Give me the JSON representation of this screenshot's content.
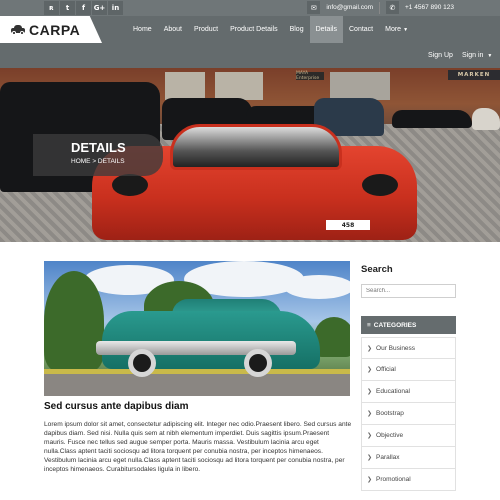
{
  "topbar": {
    "social_icons": [
      {
        "name": "rss-icon",
        "glyph": "ʀ"
      },
      {
        "name": "twitter-icon",
        "glyph": "t"
      },
      {
        "name": "facebook-icon",
        "glyph": "f"
      },
      {
        "name": "google-plus-icon",
        "glyph": "G+"
      },
      {
        "name": "linkedin-icon",
        "glyph": "in"
      }
    ],
    "email": "info@gmail.com",
    "phone": "+1 4567 890 123"
  },
  "brand": {
    "name": "CARPA"
  },
  "nav": {
    "items": [
      {
        "label": "Home",
        "active": false
      },
      {
        "label": "About",
        "active": false
      },
      {
        "label": "Product",
        "active": false
      },
      {
        "label": "Product Details",
        "active": false
      },
      {
        "label": "Blog",
        "active": false
      },
      {
        "label": "Details",
        "active": true
      },
      {
        "label": "Contact",
        "active": false
      }
    ],
    "more_label": "More",
    "more_caret": "▼"
  },
  "auth": {
    "signup_label": "Sign Up",
    "signin_label": "Sign in",
    "signin_caret": "▼"
  },
  "hero": {
    "title": "DETAILS",
    "breadcrumb_home": "HOME",
    "breadcrumb_sep": ">",
    "breadcrumb_current": "DETAILS",
    "plate": "458",
    "store_sign": "MARKEN",
    "small_sign": "MAYA Enterprise"
  },
  "post": {
    "title": "Sed cursus ante dapibus diam",
    "body": "Lorem ipsum dolor sit amet, consectetur adipiscing elit. Integer nec odio.Praesent libero. Sed cursus ante dapibus diam. Sed nisi. Nulla quis sem at nibh elementum imperdiet. Duis sagittis ipsum.Praesent mauris. Fusce nec tellus sed augue semper porta. Mauris massa. Vestibulum lacinia arcu eget nulla.Class aptent taciti sociosqu ad litora torquent per conubia nostra, per inceptos himenaeos. Vestibulum lacinia arcu eget nulla.Class aptent taciti sociosqu ad litora torquent per conubia nostra, per inceptos himenaeos. Curabitursodales ligula in libero."
  },
  "sidebar": {
    "search_heading": "Search",
    "search_placeholder": "Search...",
    "categories_heading": "CATEGORIES",
    "categories_icon": "≡",
    "chevron": "❯",
    "categories": [
      {
        "label": "Our Business"
      },
      {
        "label": "Official"
      },
      {
        "label": "Educational"
      },
      {
        "label": "Bootstrap"
      },
      {
        "label": "Objective"
      },
      {
        "label": "Parallax"
      },
      {
        "label": "Promotional"
      }
    ]
  }
}
